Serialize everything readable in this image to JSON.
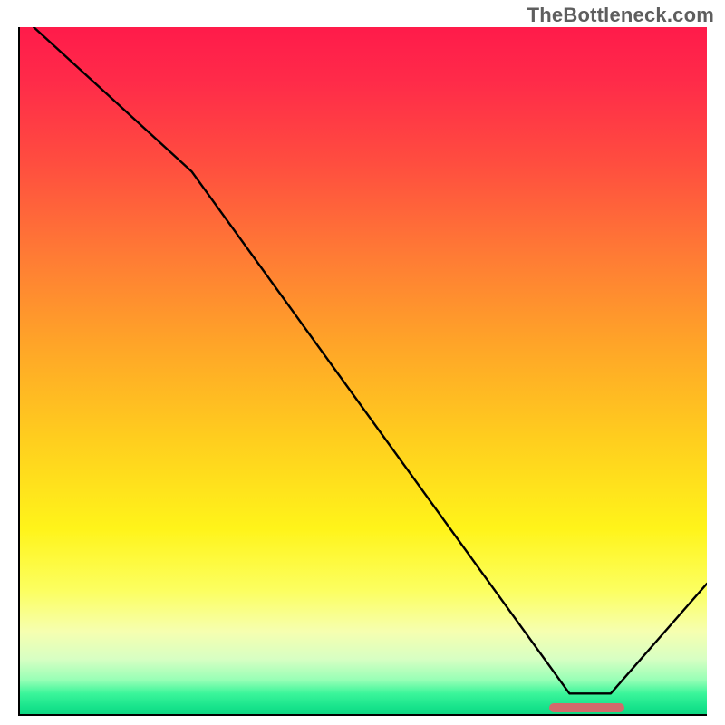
{
  "watermark": "TheBottleneck.com",
  "chart_data": {
    "type": "line",
    "title": "",
    "xlabel": "",
    "ylabel": "",
    "xlim": [
      0,
      100
    ],
    "ylim": [
      0,
      100
    ],
    "grid": false,
    "legend": null,
    "background": "vertical rainbow gradient, red (top, high bottleneck) → green (bottom, low bottleneck)",
    "series": [
      {
        "name": "bottleneck-curve",
        "description": "Piecewise line starting at top-left, descending to a minimum near x≈82, then rising toward the right edge",
        "x": [
          2,
          25,
          80,
          86,
          100
        ],
        "values": [
          100,
          79,
          3,
          3,
          19
        ],
        "color": "#000000"
      }
    ],
    "annotations": [
      {
        "name": "optimal-range-marker",
        "kind": "horizontal-bar",
        "x_range": [
          77,
          88
        ],
        "y": 1,
        "color": "#d36a6b"
      }
    ]
  }
}
